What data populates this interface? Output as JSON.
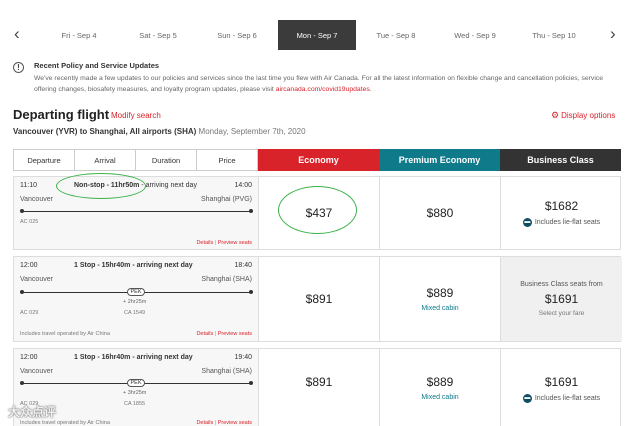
{
  "date_bar": {
    "dates": [
      "Fri - Sep 4",
      "Sat - Sep 5",
      "Sun - Sep 6",
      "Mon - Sep 7",
      "Tue - Sep 8",
      "Wed - Sep 9",
      "Thu - Sep 10"
    ],
    "active": "Mon - Sep 7",
    "prev_icon": "chevron-left-icon",
    "next_icon": "chevron-right-icon"
  },
  "notice": {
    "icon": "info-icon",
    "title": "Recent Policy and Service Updates",
    "body": "We've recently made a few updates to our policies and services since the last time you flew with Air Canada. For all the latest information on flexible change and cancellation policies, service offering changes, biosafety measures, and loyalty program updates, please visit",
    "link": "aircanada.com/covid19updates",
    "end": "."
  },
  "header": {
    "title": "Departing flight",
    "modify": "Modify search",
    "route": "Vancouver (YVR) to Shanghai, All airports (SHA)",
    "date": "Monday, September 7th, 2020",
    "display_options": "Display options",
    "display_icon": "gear-icon"
  },
  "sort": [
    "Departure",
    "Arrival",
    "Duration",
    "Price"
  ],
  "cabins": {
    "economy": "Economy",
    "premium": "Premium Economy",
    "business": "Business Class",
    "colors": {
      "economy": "#d8232a",
      "premium": "#0e7a8a",
      "business": "#333333"
    }
  },
  "flights": [
    {
      "dep_time": "11:10",
      "summary_bold": "Non-stop - 11hr50m",
      "summary_rest": " - arriving next day",
      "arr_time": "14:00",
      "origin": "Vancouver",
      "dest": "Shanghai (PVG)",
      "flight1": "AC 025",
      "details": "Details",
      "preview": "Preview seats",
      "economy": "$437",
      "premium": "$880",
      "business": "$1682",
      "business_note": "Includes lie-flat seats"
    },
    {
      "dep_time": "12:00",
      "summary_bold": "1 Stop - 15hr40m - arriving next day",
      "arr_time": "18:40",
      "origin": "Vancouver",
      "dest": "Shanghai (SHA)",
      "stop": "PEK",
      "layover": "+ 2hr25m",
      "flight1": "AC 029",
      "flight2": "CA 1549",
      "operated": "Includes travel operated by Air China",
      "details": "Details",
      "preview": "Preview seats",
      "economy": "$891",
      "premium": "$889",
      "premium_note": "Mixed cabin",
      "business_from": "Business Class seats from",
      "business": "$1691",
      "business_select": "Select your fare"
    },
    {
      "dep_time": "12:00",
      "summary_bold": "1 Stop - 16hr40m - arriving next day",
      "arr_time": "19:40",
      "origin": "Vancouver",
      "dest": "Shanghai (SHA)",
      "stop": "PEK",
      "layover": "+ 3hr25m",
      "flight1": "AC 029",
      "flight2": "CA 1855",
      "operated": "Includes travel operated by Air China",
      "details": "Details",
      "preview": "Preview seats",
      "economy": "$891",
      "premium": "$889",
      "premium_note": "Mixed cabin",
      "business": "$1691",
      "business_note": "Includes lie-flat seats"
    }
  ],
  "watermark": "大众点评",
  "annotation_color": "#3db24a"
}
